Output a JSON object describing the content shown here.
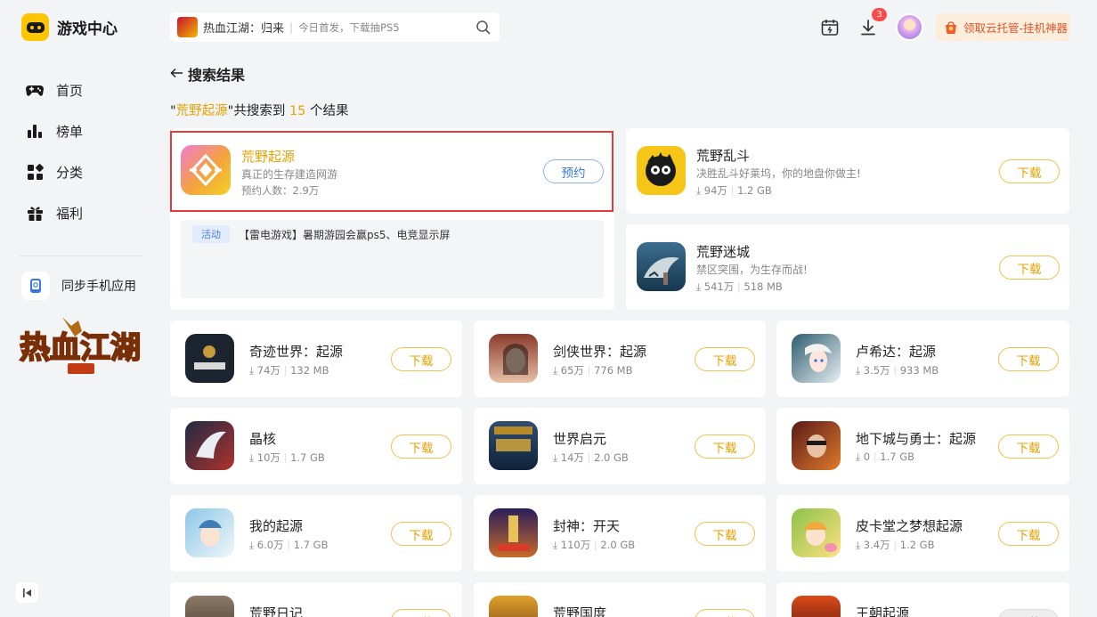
{
  "app": {
    "title": "游戏中心"
  },
  "nav": [
    {
      "label": "首页",
      "icon": "gamepad-icon"
    },
    {
      "label": "榜单",
      "icon": "bar-chart-icon"
    },
    {
      "label": "分类",
      "icon": "category-icon"
    },
    {
      "label": "福利",
      "icon": "gift-icon"
    }
  ],
  "sync": {
    "label": "同步手机应用"
  },
  "search": {
    "game": "热血江湖：归来",
    "hint": "今日首发，下载抽PS5"
  },
  "downloads_badge": "3",
  "cloud_button": "领取云托管-挂机神器",
  "page_title": "搜索结果",
  "summary": {
    "q_open": "\"",
    "query": "荒野起源",
    "q_close": "\"",
    "pre": "共搜索到",
    "count": "15",
    "post": "个结果"
  },
  "featured": {
    "name": "荒野起源",
    "desc": "真正的生存建造网游",
    "meta": "预约人数：2.9万",
    "button": "预约"
  },
  "activity": {
    "tag": "活动",
    "text": "【雷电游戏】暑期游园会赢ps5、电竞显示屏"
  },
  "side_apps": [
    {
      "name": "荒野乱斗",
      "desc": "决胜乱斗好莱坞，你的地盘你做主!",
      "downloads": "94万",
      "size": "1.2 GB",
      "button": "下载"
    },
    {
      "name": "荒野迷城",
      "desc": "禁区突围，为生存而战!",
      "downloads": "541万",
      "size": "518 MB",
      "button": "下载"
    }
  ],
  "grid_apps": [
    {
      "name": "奇迹世界：起源",
      "downloads": "74万",
      "size": "132 MB",
      "button": "下载"
    },
    {
      "name": "剑侠世界：起源",
      "downloads": "65万",
      "size": "776 MB",
      "button": "下载"
    },
    {
      "name": "卢希达：起源",
      "downloads": "3.5万",
      "size": "933 MB",
      "button": "下载"
    },
    {
      "name": "晶核",
      "downloads": "10万",
      "size": "1.7 GB",
      "button": "下载"
    },
    {
      "name": "世界启元",
      "downloads": "14万",
      "size": "2.0 GB",
      "button": "下载"
    },
    {
      "name": "地下城与勇士：起源",
      "downloads": "0",
      "size": "1.7 GB",
      "button": "下载"
    },
    {
      "name": "我的起源",
      "downloads": "6.0万",
      "size": "1.7 GB",
      "button": "下载"
    },
    {
      "name": "封神：开天",
      "downloads": "110万",
      "size": "2.0 GB",
      "button": "下载"
    },
    {
      "name": "皮卡堂之梦想起源",
      "downloads": "3.4万",
      "size": "1.2 GB",
      "button": "下载"
    },
    {
      "name": "荒野日记",
      "downloads": "",
      "size": "",
      "button": "下载"
    },
    {
      "name": "荒野国度",
      "downloads": "",
      "size": "",
      "button": "下载"
    },
    {
      "name": "王朝起源",
      "downloads": "",
      "size": "",
      "button": "下载"
    }
  ],
  "colors": {
    "accent": "#e8a100",
    "brand": "#ffc500",
    "highlight": "#e33a3a",
    "reserve": "#3a78e0"
  }
}
